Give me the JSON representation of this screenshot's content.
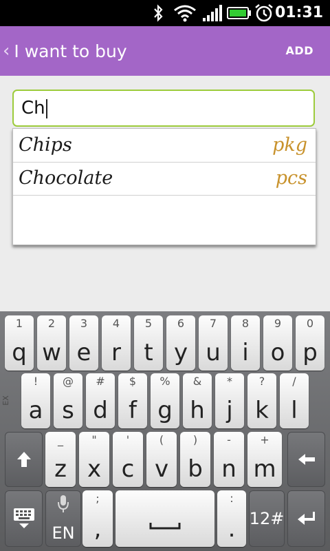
{
  "status_bar": {
    "time": "01:31",
    "icons": [
      "bluetooth-icon",
      "wifi-icon",
      "signal-icon",
      "battery-icon",
      "alarm-icon"
    ]
  },
  "action_bar": {
    "back_glyph": "‹",
    "title": "I want to buy",
    "add_label": "ADD",
    "color": "#a366c7"
  },
  "search": {
    "value": "Ch"
  },
  "suggestions": [
    {
      "name": "Chips",
      "unit": "pkg"
    },
    {
      "name": "Chocolate",
      "unit": "pcs"
    }
  ],
  "keyboard": {
    "row1": [
      {
        "hint": "1",
        "key": "q"
      },
      {
        "hint": "2",
        "key": "w"
      },
      {
        "hint": "3",
        "key": "e"
      },
      {
        "hint": "4",
        "key": "r"
      },
      {
        "hint": "5",
        "key": "t"
      },
      {
        "hint": "6",
        "key": "y"
      },
      {
        "hint": "7",
        "key": "u"
      },
      {
        "hint": "8",
        "key": "i"
      },
      {
        "hint": "9",
        "key": "o"
      },
      {
        "hint": "0",
        "key": "p"
      }
    ],
    "row2": [
      {
        "hint": "!",
        "key": "a"
      },
      {
        "hint": "@",
        "key": "s"
      },
      {
        "hint": "#",
        "key": "d"
      },
      {
        "hint": "$",
        "key": "f"
      },
      {
        "hint": "%",
        "key": "g"
      },
      {
        "hint": "&",
        "key": "h"
      },
      {
        "hint": "*",
        "key": "j"
      },
      {
        "hint": "?",
        "key": "k"
      },
      {
        "hint": "/",
        "key": "l"
      }
    ],
    "row3": [
      {
        "hint": "_",
        "key": "z"
      },
      {
        "hint": "\"",
        "key": "x"
      },
      {
        "hint": "'",
        "key": "c"
      },
      {
        "hint": "(",
        "key": "v"
      },
      {
        "hint": ")",
        "key": "b"
      },
      {
        "hint": "-",
        "key": "n"
      },
      {
        "hint": "+",
        "key": "m"
      }
    ],
    "side_label": "EX",
    "lang_label": "EN",
    "comma_hint": ";",
    "comma_key": ",",
    "period_hint": ":",
    "period_key": ".",
    "numbers_label": "12#"
  }
}
